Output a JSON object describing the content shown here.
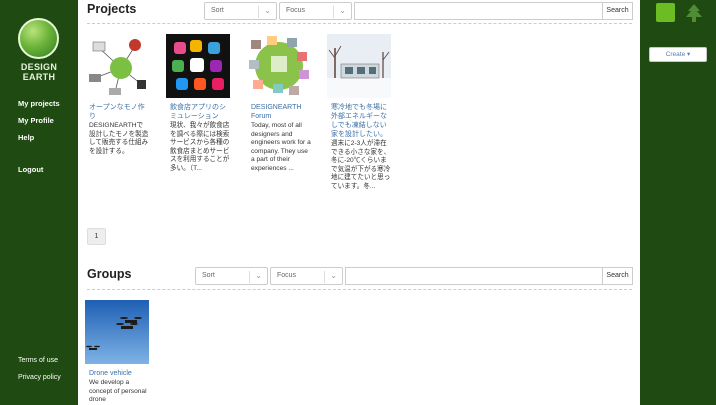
{
  "sidebar": {
    "logo_line1": "DESIGN",
    "logo_line2": "EARTH",
    "nav": [
      "My projects",
      "My Profile",
      "Help",
      "Logout"
    ],
    "footer": [
      "Terms of use",
      "Privacy policy"
    ]
  },
  "rightbar": {
    "create_label": "Create ▾",
    "tree_icon": "tree-icon",
    "square_color": "#6cbc24"
  },
  "projects": {
    "title": "Projects",
    "sort_label": "Sort",
    "focus_label": "Focus",
    "search_value": "",
    "search_button": "Search",
    "items": [
      {
        "title": "オープンなモノ作り",
        "desc": "DESIGNEARTHで設計したモノを製造して販売する仕組みを設計する。"
      },
      {
        "title": "飲食店アプリのシミュレーション",
        "desc": "現状、我々が飲食店を調べる際には検索サービスから各種の飲食店まとめサービスを利用することが多い。（T..."
      },
      {
        "title": "DESIGNEARTH Forum",
        "desc": "Today, most of all designers and engineers work for a company. They use a part of their experiences ..."
      },
      {
        "title": "寒冷地でも冬場に外部エネルギーなしでも凍結しない家を設計したい。",
        "desc": "週末に2-3人が滞在できる小さな家を、冬に-20℃くらいまで気温が下がる寒冷地に建てたいと思っています。冬..."
      }
    ],
    "page": "1"
  },
  "groups": {
    "title": "Groups",
    "sort_label": "Sort",
    "focus_label": "Focus",
    "search_value": "",
    "search_button": "Search",
    "items": [
      {
        "title": "Drone vehicle",
        "desc": "We develop a concept of personal drone"
      }
    ]
  },
  "colors": {
    "sidebar_bg": "#1f4a12",
    "link": "#3b6fa8",
    "accent_green": "#6cbc24"
  }
}
